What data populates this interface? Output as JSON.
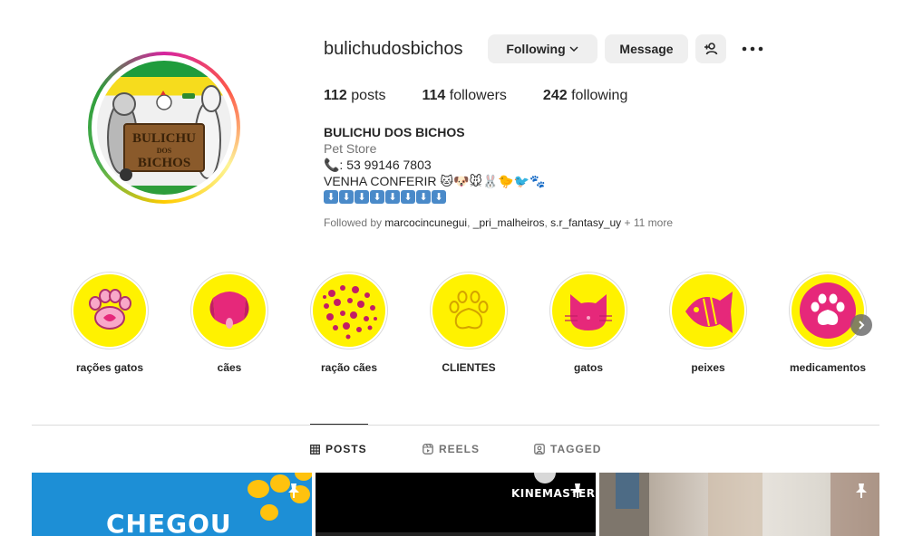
{
  "profile": {
    "username": "bulichudosbichos",
    "avatar_logo_line1": "BULICHU",
    "avatar_logo_line2": "DOS",
    "avatar_logo_line3": "BICHOS"
  },
  "actions": {
    "following_label": "Following",
    "message_label": "Message",
    "add_user_icon": "person-add-icon",
    "more_icon": "more-horizontal-icon"
  },
  "stats": {
    "posts_count": "112",
    "posts_label": "posts",
    "followers_count": "114",
    "followers_label": "followers",
    "following_count": "242",
    "following_label": "following"
  },
  "bio": {
    "name": "BULICHU DOS BICHOS",
    "category": "Pet Store",
    "phone_line": "📞: 53 99146 7803",
    "promo_line": "VENHA CONFERIR 🐱🐶🐭🐰🐤🐦🐾",
    "arrows": [
      "⬇",
      "⬇",
      "⬇",
      "⬇",
      "⬇",
      "⬇",
      "⬇",
      "⬇"
    ]
  },
  "followed_by": {
    "prefix": "Followed by ",
    "user1": "marcocincunegui",
    "sep1": ", ",
    "user2": "_pri_malheiros",
    "sep2": ", ",
    "user3": "s.r_fantasy_uy",
    "more": " + 11 more"
  },
  "highlights": [
    {
      "label": "rações gatos",
      "icon": "cat-paw-icon"
    },
    {
      "label": "cães",
      "icon": "dog-face-icon"
    },
    {
      "label": "ração cães",
      "icon": "paw-pattern-icon"
    },
    {
      "label": "CLIENTES",
      "icon": "paw-outline-icon"
    },
    {
      "label": "gatos",
      "icon": "cat-face-icon"
    },
    {
      "label": "peixes",
      "icon": "fish-icon"
    },
    {
      "label": "medicamentos",
      "icon": "paw-circle-icon"
    }
  ],
  "tabs": [
    {
      "label": "POSTS",
      "icon": "grid-icon",
      "active": true
    },
    {
      "label": "REELS",
      "icon": "reels-icon",
      "active": false
    },
    {
      "label": "TAGGED",
      "icon": "tagged-icon",
      "active": false
    }
  ],
  "posts": [
    {
      "text": "CHEGOU",
      "pinned": true
    },
    {
      "text": "KINEMASTER",
      "pinned": true
    },
    {
      "text": "",
      "pinned": true
    }
  ],
  "colors": {
    "highlight_yellow": "#fff200",
    "highlight_pink": "#e6287a",
    "button_gray": "#efefef"
  }
}
